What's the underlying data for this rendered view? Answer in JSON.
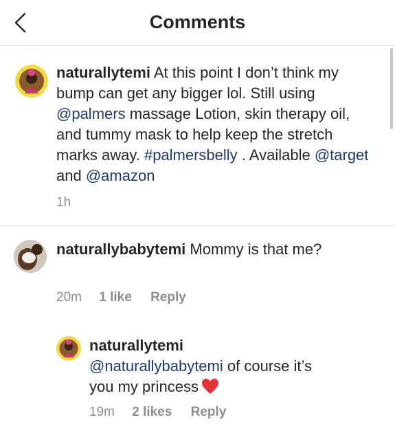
{
  "header": {
    "title": "Comments",
    "back_icon": "chevron-left-icon"
  },
  "caption": {
    "username": "naturallytemi",
    "text_part1": " At this point I don’t think my bump can get any bigger lol. Still using ",
    "mention1": "@palmers",
    "text_part2": " massage Lotion, skin therapy oil, and tummy mask to help keep the stretch marks away. ",
    "hashtag": "#palmersbelly",
    "text_part3": " . Available ",
    "mention2": "@target",
    "text_part4": " and ",
    "mention3": "@amazon",
    "time": "1h"
  },
  "comments": [
    {
      "username": "naturallybabytemi",
      "text": " Mommy is that me?",
      "time": "20m",
      "likes": "1 like",
      "reply_label": "Reply"
    }
  ],
  "replies": [
    {
      "username": "naturallytemi",
      "mention": "@naturallybabytemi",
      "text": " of course it’s you my princess",
      "emoji": "heart",
      "time": "19m",
      "likes": "2 likes",
      "reply_label": "Reply"
    }
  ],
  "colors": {
    "link": "#1f3a6b",
    "meta": "#8e8e8e",
    "divider": "#dbdbdb",
    "heart": "#e0333a",
    "avatar_ring": "#f2d84a"
  }
}
